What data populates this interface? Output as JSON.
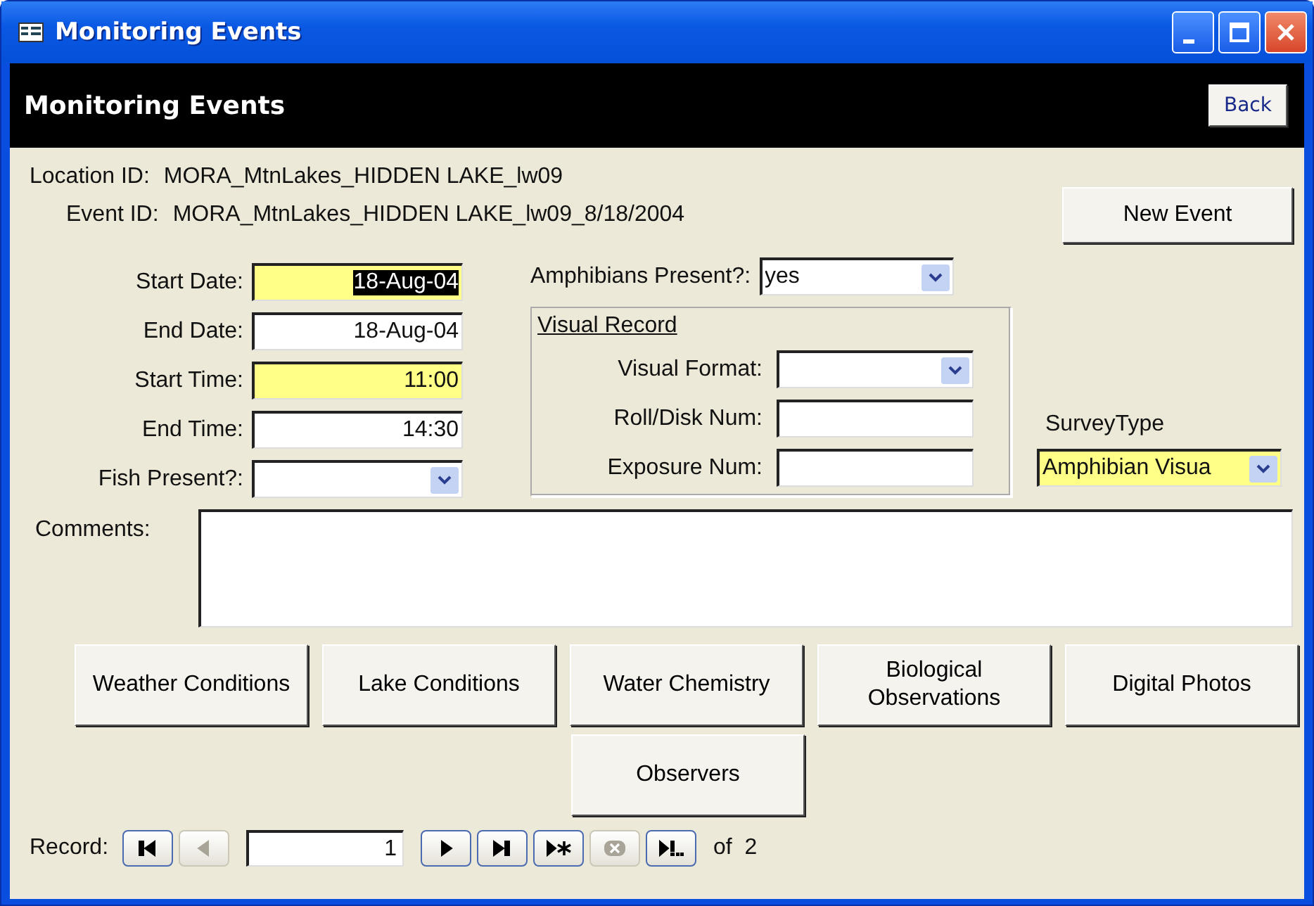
{
  "window": {
    "title": "Monitoring Events"
  },
  "header": {
    "title": "Monitoring Events",
    "back_button": "Back"
  },
  "location": {
    "label": "Location ID:",
    "value": "MORA_MtnLakes_HIDDEN LAKE_lw09"
  },
  "event": {
    "label": "Event ID:",
    "value": "MORA_MtnLakes_HIDDEN LAKE_lw09_8/18/2004"
  },
  "new_event_button": "New Event",
  "left_fields": [
    {
      "label": "Start Date:",
      "value": "18-Aug-04",
      "kind": "text",
      "highlighted": true,
      "text_selected": true
    },
    {
      "label": "End Date:",
      "value": "18-Aug-04",
      "kind": "text",
      "highlighted": false,
      "text_selected": false
    },
    {
      "label": "Start Time:",
      "value": "11:00",
      "kind": "text",
      "highlighted": true,
      "text_selected": false
    },
    {
      "label": "End Time:",
      "value": "14:30",
      "kind": "text",
      "highlighted": false,
      "text_selected": false
    },
    {
      "label": "Fish Present?:",
      "kind": "combo",
      "highlighted": false
    }
  ],
  "amphibians": {
    "label": "Amphibians Present?:",
    "value": "yes",
    "kind": "combo",
    "highlighted": false,
    "text_selected": false
  },
  "visual_record": {
    "title": "Visual Record",
    "fields": [
      {
        "label": "Visual Format:",
        "kind": "combo",
        "highlighted": false
      },
      {
        "label": "Roll/Disk Num:",
        "kind": "text",
        "highlighted": false
      },
      {
        "label": "Exposure Num:",
        "kind": "text",
        "highlighted": false
      }
    ]
  },
  "survey_type": {
    "label": "SurveyType",
    "value": "Amphibian Visua",
    "kind": "combo",
    "highlighted": true,
    "text_selected": false
  },
  "comments": {
    "label": "Comments:"
  },
  "buttons": [
    "Weather Conditions",
    "Lake Conditions",
    "Water Chemistry",
    "Biological Observations",
    "Digital Photos"
  ],
  "observers_button": "Observers",
  "navigation": {
    "label": "Record:",
    "current": "1",
    "total": "of  2",
    "buttons": [
      {
        "kind": "first",
        "disabled": false
      },
      {
        "kind": "previous",
        "disabled": true
      },
      {
        "kind": "next",
        "disabled": false
      },
      {
        "kind": "last",
        "disabled": false
      },
      {
        "kind": "new",
        "disabled": false
      },
      {
        "kind": "delete",
        "disabled": true
      },
      {
        "kind": "jump",
        "disabled": false
      }
    ]
  }
}
